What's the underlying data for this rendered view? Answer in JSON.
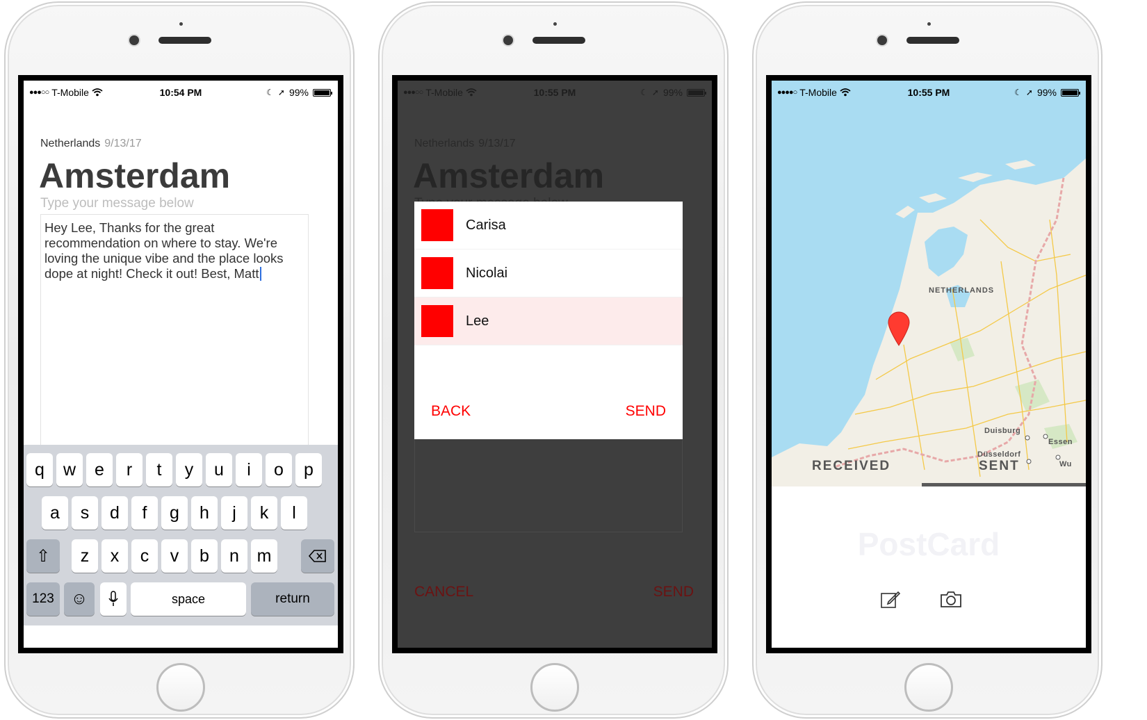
{
  "status": {
    "carrier": "T-Mobile",
    "battery": "99%",
    "time_left": "10:54 PM",
    "time_middle": "10:55 PM",
    "time_right": "10:55 PM"
  },
  "compose": {
    "country": "Netherlands",
    "date": "9/13/17",
    "city": "Amsterdam",
    "placeholder": "Type your message below",
    "message": "Hey Lee,  Thanks for the great recommendation on where to stay. We're loving the unique vibe and the place looks dope at night! Check it out! Best, Matt"
  },
  "keyboard": {
    "row1": [
      "q",
      "w",
      "e",
      "r",
      "t",
      "y",
      "u",
      "i",
      "o",
      "p"
    ],
    "row2": [
      "a",
      "s",
      "d",
      "f",
      "g",
      "h",
      "j",
      "k",
      "l"
    ],
    "row3": [
      "z",
      "x",
      "c",
      "v",
      "b",
      "n",
      "m"
    ],
    "numbers": "123",
    "space": "space",
    "return": "return"
  },
  "picker": {
    "contacts": [
      {
        "name": "Carisa",
        "color": "#ff0000"
      },
      {
        "name": "Nicolai",
        "color": "#ff0000"
      },
      {
        "name": "Lee",
        "color": "#ff0000",
        "selected": true
      }
    ],
    "back": "BACK",
    "send": "SEND",
    "cancel": "CANCEL",
    "footer_send": "SEND",
    "accent": "#ff0000"
  },
  "map": {
    "country_label": "NETHERLANDS",
    "received": "RECEIVED",
    "sent": "SENT",
    "city1": "Duisburg",
    "city2": "Düsseldorf",
    "city3": "Essen",
    "city4": "Wu",
    "brand": "PostCard",
    "pin_color": "#ff3b30",
    "water_color": "#a9dcf2",
    "land_color": "#f2efe6"
  },
  "icons": [
    "wifi-icon",
    "location-arrow-icon",
    "moon-icon",
    "shift-icon",
    "delete-icon",
    "emoji-icon",
    "microphone-icon",
    "compose-icon",
    "camera-icon",
    "map-pin-icon"
  ]
}
